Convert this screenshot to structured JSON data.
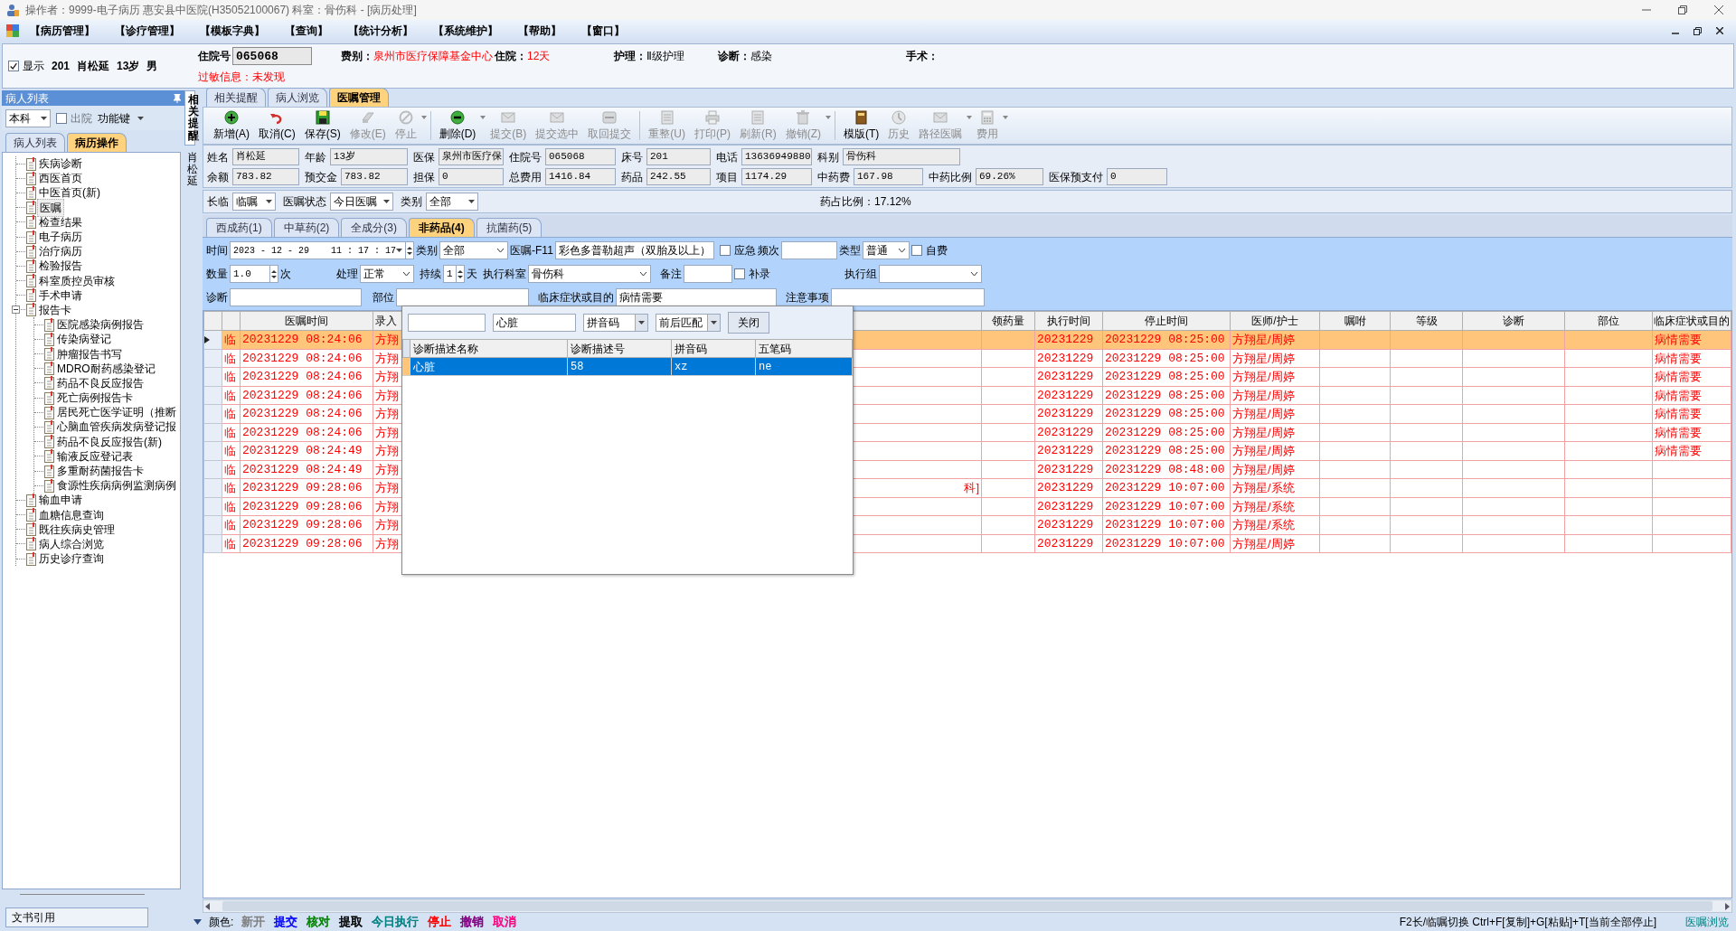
{
  "window": {
    "title": "操作者：9999-电子病历  惠安县中医院(H35052100067)  科室：骨伤科 - [病历处理]"
  },
  "menu": [
    "【病历管理】",
    "【诊疗管理】",
    "【模板字典】",
    "【查询】",
    "【统计分析】",
    "【系统维护】",
    "【帮助】",
    "【窗口】"
  ],
  "patient_bar": {
    "show": {
      "label": "显示",
      "checked": true
    },
    "summary": [
      "201",
      "肖松延",
      "13岁",
      "男"
    ],
    "fields": [
      {
        "label": "住院号",
        "value": "065068",
        "kind": "input",
        "alert": false
      },
      {
        "label": "费别：",
        "value": "泉州市医疗保障基金中心",
        "kind": "text",
        "alert": true
      },
      {
        "label": "住院：",
        "value": "12天",
        "kind": "text",
        "alert": true
      },
      {
        "label": "护理：",
        "value": "Ⅱ级护理",
        "kind": "text",
        "alert": false
      },
      {
        "label": "诊断：",
        "value": "感染",
        "kind": "text",
        "alert": false
      },
      {
        "label": "手术：",
        "kind": "text",
        "alert": false
      }
    ],
    "allergy": {
      "label": "过敏信息：",
      "value": "未发现"
    }
  },
  "sidebar": {
    "title": "病人列表",
    "scope": "本科",
    "discharged": {
      "label": "出院",
      "checked": false
    },
    "function_key": "功能键",
    "tabs": [
      {
        "label": "病人列表",
        "selected": false
      },
      {
        "label": "病历操作",
        "selected": true
      }
    ],
    "tree": [
      {
        "label": "疾病诊断",
        "selected": false
      },
      {
        "label": "西医首页",
        "selected": false
      },
      {
        "label": "中医首页(新)",
        "selected": false
      },
      {
        "label": "医嘱",
        "selected": true
      },
      {
        "label": "检查结果",
        "selected": false
      },
      {
        "label": "电子病历",
        "selected": false
      },
      {
        "label": "治疗病历",
        "selected": false
      },
      {
        "label": "检验报告",
        "selected": false
      },
      {
        "label": "科室质控员审核",
        "selected": false
      },
      {
        "label": "手术申请",
        "selected": false
      },
      {
        "label": "报告卡",
        "selected": false,
        "expanded": true,
        "children": [
          {
            "label": "医院感染病例报告",
            "selected": false
          },
          {
            "label": "传染病登记",
            "selected": false
          },
          {
            "label": "肿瘤报告书写",
            "selected": false
          },
          {
            "label": "MDRO耐药感染登记",
            "selected": false
          },
          {
            "label": "药品不良反应报告",
            "selected": false
          },
          {
            "label": "死亡病例报告卡",
            "selected": false
          },
          {
            "label": "居民死亡医学证明（推断",
            "selected": false
          },
          {
            "label": "心脑血管疾病发病登记报",
            "selected": false
          },
          {
            "label": "药品不良反应报告(新)",
            "selected": false
          },
          {
            "label": "输液反应登记表",
            "selected": false
          },
          {
            "label": "多重耐药菌报告卡",
            "selected": false
          },
          {
            "label": "食源性疾病病例监测病例",
            "selected": false
          }
        ]
      },
      {
        "label": "输血申请",
        "selected": false
      },
      {
        "label": "血糖信息查询",
        "selected": false
      },
      {
        "label": "既往疾病史管理",
        "selected": false
      },
      {
        "label": "病人综合浏览",
        "selected": false
      },
      {
        "label": "历史诊疗查询",
        "selected": false
      }
    ],
    "footer_button": "文书引用"
  },
  "side_tabs": [
    {
      "label": "相关提醒",
      "selected": true
    },
    {
      "label": "肖松延",
      "selected": false
    }
  ],
  "main_tabs": [
    {
      "label": "相关提醒",
      "selected": false
    },
    {
      "label": "病人浏览",
      "selected": false
    },
    {
      "label": "医嘱管理",
      "selected": true
    }
  ],
  "toolbar": [
    {
      "label": "新增(A)",
      "disabled": false,
      "dropdown": false
    },
    {
      "label": "取消(C)",
      "disabled": false,
      "dropdown": false
    },
    {
      "label": "保存(S)",
      "disabled": false,
      "dropdown": false
    },
    {
      "label": "修改(E)",
      "disabled": true,
      "dropdown": false
    },
    {
      "label": "停止",
      "disabled": true,
      "dropdown": true
    },
    {
      "label": "删除(D)",
      "disabled": false,
      "dropdown": true
    },
    {
      "label": "提交(B)",
      "disabled": true,
      "dropdown": false
    },
    {
      "label": "提交选中",
      "disabled": true,
      "dropdown": false
    },
    {
      "label": "取回提交",
      "disabled": true,
      "dropdown": false
    },
    {
      "label": "重整(U)",
      "disabled": true,
      "dropdown": false
    },
    {
      "label": "打印(P)",
      "disabled": true,
      "dropdown": false
    },
    {
      "label": "刷新(R)",
      "disabled": true,
      "dropdown": false
    },
    {
      "label": "撤销(Z)",
      "disabled": true,
      "dropdown": true
    },
    {
      "label": "模版(T)",
      "disabled": false,
      "dropdown": false
    },
    {
      "label": "历史",
      "disabled": true,
      "dropdown": false
    },
    {
      "label": "路径医嘱",
      "disabled": true,
      "dropdown": true
    },
    {
      "label": "费用",
      "disabled": true,
      "dropdown": true
    }
  ],
  "info": [
    [
      {
        "label": "姓名",
        "value": "肖松延"
      },
      {
        "label": "年龄",
        "value": "13岁"
      },
      {
        "label": "医保",
        "value": "泉州市医疗保"
      },
      {
        "label": "住院号",
        "value": "065068"
      },
      {
        "label": "床号",
        "value": "201"
      },
      {
        "label": "电话",
        "value": "13636949880"
      },
      {
        "label": "科别",
        "value": "骨伤科"
      }
    ],
    [
      {
        "label": "余额",
        "value": "783.82"
      },
      {
        "label": "预交金",
        "value": "783.82"
      },
      {
        "label": "担保",
        "value": "0"
      },
      {
        "label": "总费用",
        "value": "1416.84"
      },
      {
        "label": "药品",
        "value": "242.55"
      },
      {
        "label": "项目",
        "value": "1174.29"
      },
      {
        "label": "中药费",
        "value": "167.98"
      },
      {
        "label": "中药比例",
        "value": "69.26%"
      },
      {
        "label": "医保预支付",
        "value": "0"
      }
    ]
  ],
  "filter": {
    "items": [
      {
        "label": "长临",
        "value": "临嘱"
      },
      {
        "label": "医嘱状态",
        "value": "今日医嘱"
      },
      {
        "label": "类别",
        "value": "全部"
      }
    ],
    "drug_ratio": "药占比例：17.12%"
  },
  "order_tabs": [
    {
      "label": "西成药(1)",
      "selected": false
    },
    {
      "label": "中草药(2)",
      "selected": false
    },
    {
      "label": "全成分(3)",
      "selected": false
    },
    {
      "label": "非药品(4)",
      "selected": true
    },
    {
      "label": "抗菌药(5)",
      "selected": false
    }
  ],
  "order_form": [
    [
      {
        "kind": "label",
        "text": "时间"
      },
      {
        "kind": "datetime",
        "value": "2023 - 12 - 29    11 : 17 : 17"
      },
      {
        "kind": "label",
        "text": "类别"
      },
      {
        "kind": "select",
        "value": "全部"
      },
      {
        "kind": "label",
        "text": "医嘱-F11"
      },
      {
        "kind": "input",
        "value": "彩色多普勒超声（双胎及以上）"
      },
      {
        "kind": "check",
        "label": "应急",
        "checked": false
      },
      {
        "kind": "label",
        "text": "频次"
      },
      {
        "kind": "input"
      },
      {
        "kind": "label",
        "text": "类型"
      },
      {
        "kind": "select",
        "value": "普通"
      },
      {
        "kind": "check",
        "label": "自费",
        "checked": false
      }
    ],
    [
      {
        "kind": "label",
        "text": "数量"
      },
      {
        "kind": "spin",
        "value": "1.0"
      },
      {
        "kind": "label",
        "text": "次"
      },
      {
        "kind": "label",
        "text": "处理"
      },
      {
        "kind": "select",
        "value": "正常"
      },
      {
        "kind": "label",
        "text": "持续"
      },
      {
        "kind": "spin",
        "value": "1"
      },
      {
        "kind": "label",
        "text": "天"
      },
      {
        "kind": "label",
        "text": "执行科室"
      },
      {
        "kind": "select",
        "value": "骨伤科"
      },
      {
        "kind": "label",
        "text": "备注"
      },
      {
        "kind": "input"
      },
      {
        "kind": "check",
        "label": "补录",
        "checked": false
      },
      {
        "kind": "label",
        "text": "执行组"
      },
      {
        "kind": "select"
      }
    ],
    [
      {
        "kind": "label",
        "text": "诊断"
      },
      {
        "kind": "input"
      },
      {
        "kind": "label",
        "text": "部位"
      },
      {
        "kind": "input"
      },
      {
        "kind": "label",
        "text": "临床症状或目的"
      },
      {
        "kind": "input",
        "value": "病情需要"
      },
      {
        "kind": "label",
        "text": "注意事项"
      },
      {
        "kind": "input"
      }
    ]
  ],
  "table": {
    "columns": [
      {},
      {
        "label": "医嘱时间"
      },
      {
        "label": "录入"
      },
      {},
      {
        "label": "领药量"
      },
      {
        "label": "执行时间"
      },
      {
        "label": "停止时间"
      },
      {
        "label": "医师/护士"
      },
      {
        "label": "嘱咐"
      },
      {
        "label": "等级"
      },
      {
        "label": "诊断"
      },
      {
        "label": "部位"
      },
      {
        "label": "临床症状或目的"
      }
    ],
    "rows": [
      {
        "selected": true,
        "cells": [
          "临",
          "20231229 08:24:06",
          "方翔",
          null,
          null,
          "20231229",
          "20231229 08:25:00",
          "方翔星/周婷",
          null,
          null,
          null,
          null,
          "病情需要"
        ]
      },
      {
        "selected": false,
        "cells": [
          "临",
          "20231229 08:24:06",
          "方翔",
          null,
          null,
          "20231229",
          "20231229 08:25:00",
          "方翔星/周婷",
          null,
          null,
          null,
          null,
          "病情需要"
        ]
      },
      {
        "selected": false,
        "cells": [
          "临",
          "20231229 08:24:06",
          "方翔",
          null,
          null,
          "20231229",
          "20231229 08:25:00",
          "方翔星/周婷",
          null,
          null,
          null,
          null,
          "病情需要"
        ]
      },
      {
        "selected": false,
        "cells": [
          "临",
          "20231229 08:24:06",
          "方翔",
          null,
          null,
          "20231229",
          "20231229 08:25:00",
          "方翔星/周婷",
          null,
          null,
          null,
          null,
          "病情需要"
        ]
      },
      {
        "selected": false,
        "cells": [
          "临",
          "20231229 08:24:06",
          "方翔",
          null,
          null,
          "20231229",
          "20231229 08:25:00",
          "方翔星/周婷",
          null,
          null,
          null,
          null,
          "病情需要"
        ]
      },
      {
        "selected": false,
        "cells": [
          "临",
          "20231229 08:24:06",
          "方翔",
          null,
          null,
          "20231229",
          "20231229 08:25:00",
          "方翔星/周婷",
          null,
          null,
          null,
          null,
          "病情需要"
        ]
      },
      {
        "selected": false,
        "cells": [
          "临",
          "20231229 08:24:49",
          "方翔",
          null,
          null,
          "20231229",
          "20231229 08:25:00",
          "方翔星/周婷",
          null,
          null,
          null,
          null,
          "病情需要"
        ]
      },
      {
        "selected": false,
        "cells": [
          "临",
          "20231229 08:24:49",
          "方翔",
          null,
          null,
          "20231229",
          "20231229 08:48:00",
          "方翔星/周婷",
          null,
          null,
          null,
          null,
          null
        ]
      },
      {
        "selected": false,
        "cells": [
          "临",
          "20231229 09:28:06",
          "方翔",
          "科]",
          null,
          "20231229",
          "20231229 10:07:00",
          "方翔星/系统",
          null,
          null,
          null,
          null,
          null
        ]
      },
      {
        "selected": false,
        "cells": [
          "临",
          "20231229 09:28:06",
          "方翔",
          null,
          null,
          "20231229",
          "20231229 10:07:00",
          "方翔星/系统",
          null,
          null,
          null,
          null,
          null
        ]
      },
      {
        "selected": false,
        "cells": [
          "临",
          "20231229 09:28:06",
          "方翔",
          null,
          null,
          "20231229",
          "20231229 10:07:00",
          "方翔星/系统",
          null,
          null,
          null,
          null,
          null
        ]
      },
      {
        "selected": false,
        "cells": [
          "临",
          "20231229 09:28:06",
          "方翔",
          null,
          null,
          "20231229",
          "20231229 10:07:00",
          "方翔星/周婷",
          null,
          null,
          null,
          null,
          null
        ]
      }
    ]
  },
  "lookup": {
    "keyword": "心脏",
    "match_field": "拼音码",
    "match_mode": "前后匹配",
    "close": "关闭",
    "columns": [
      "诊断描述名称",
      "诊断描述号",
      "拼音码",
      "五笔码"
    ],
    "rows": [
      {
        "selected": true,
        "cells": [
          "心脏",
          "58",
          "xz",
          "ne"
        ]
      }
    ]
  },
  "status_bar": {
    "legend_label": "颜色:",
    "legend": [
      {
        "label": "新开",
        "color": "#808080"
      },
      {
        "label": "提交",
        "color": "#0000ff"
      },
      {
        "label": "核对",
        "color": "#008000"
      },
      {
        "label": "提取",
        "color": "#000000"
      },
      {
        "label": "今日执行",
        "color": "#008080"
      },
      {
        "label": "停止",
        "color": "#ff0000"
      },
      {
        "label": "撤销",
        "color": "#800080"
      },
      {
        "label": "取消",
        "color": "#ff0080"
      }
    ],
    "hint": "F2长/临嘱切换 Ctrl+F[复制]+G[粘贴]+T[当前全部停止]",
    "view": "医嘱浏览"
  }
}
